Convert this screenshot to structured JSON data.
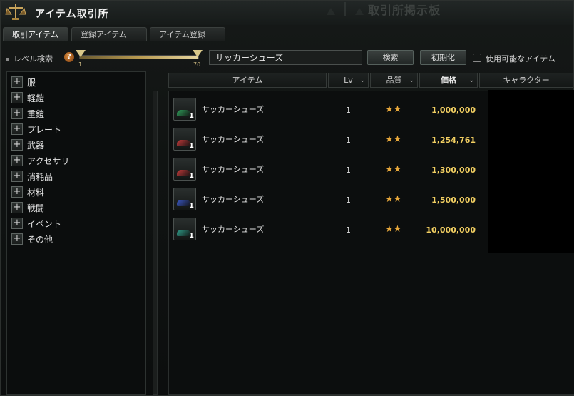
{
  "window": {
    "title": "アイテム取引所",
    "background_title": "取引所掲示板"
  },
  "tabs": [
    {
      "label": "取引アイテム",
      "active": true
    },
    {
      "label": "登録アイテム",
      "active": false
    },
    {
      "label": "アイテム登録",
      "active": false
    }
  ],
  "search": {
    "level_label": "レベル検索",
    "help_icon": "question-icon",
    "help_glyph": "?",
    "level_min": "1",
    "level_max": "70",
    "query": "サッカーシューズ",
    "search_button": "検索",
    "reset_button": "初期化",
    "usable_only_label": "使用可能なアイテム",
    "usable_only_checked": false
  },
  "categories": [
    {
      "label": "服"
    },
    {
      "label": "軽鎧"
    },
    {
      "label": "重鎧"
    },
    {
      "label": "プレート"
    },
    {
      "label": "武器"
    },
    {
      "label": "アクセサリ"
    },
    {
      "label": "消耗品"
    },
    {
      "label": "材料"
    },
    {
      "label": "戦闘"
    },
    {
      "label": "イベント"
    },
    {
      "label": "その他"
    }
  ],
  "category_expand_glyph": "+",
  "table": {
    "headers": {
      "item": "アイテム",
      "lv": "Lv",
      "quality": "品質",
      "price": "価格",
      "character": "キャラクター"
    },
    "sort_glyph": "⌄",
    "rows": [
      {
        "name": "サッカーシューズ",
        "qty": "1",
        "lv": "1",
        "quality": "★★",
        "price": "1,000,000",
        "shoe_color": "#2f9e5a"
      },
      {
        "name": "サッカーシューズ",
        "qty": "1",
        "lv": "1",
        "quality": "★★",
        "price": "1,254,761",
        "shoe_color": "#c23a3a"
      },
      {
        "name": "サッカーシューズ",
        "qty": "1",
        "lv": "1",
        "quality": "★★",
        "price": "1,300,000",
        "shoe_color": "#c23a3a"
      },
      {
        "name": "サッカーシューズ",
        "qty": "1",
        "lv": "1",
        "quality": "★★",
        "price": "1,500,000",
        "shoe_color": "#3a58c4"
      },
      {
        "name": "サッカーシューズ",
        "qty": "1",
        "lv": "1",
        "quality": "★★",
        "price": "10,000,000",
        "shoe_color": "#2f9e8a"
      }
    ]
  },
  "colors": {
    "price": "#f2cf62",
    "stars": "#e9a93c",
    "accent": "#d9c88a"
  }
}
